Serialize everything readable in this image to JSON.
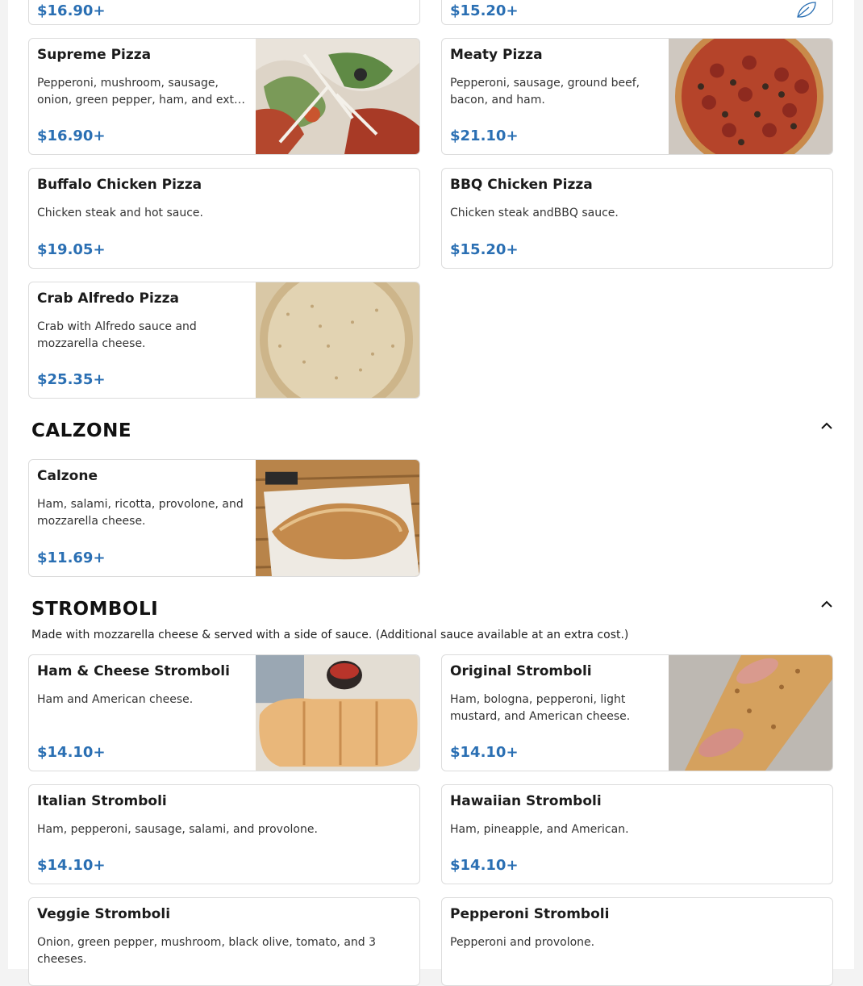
{
  "top_partial": {
    "left_price": "$16.90+",
    "right_price": "$15.20+",
    "right_icon": "leaf-icon"
  },
  "pizza": {
    "items": [
      {
        "name": "Supreme Pizza",
        "desc": "Pepperoni, mushroom, sausage,\nonion, green pepper, ham, and ext…",
        "price": "$16.90+"
      },
      {
        "name": "Meaty Pizza",
        "desc": "Pepperoni, sausage, ground beef,\nbacon, and ham.",
        "price": "$21.10+"
      },
      {
        "name": "Buffalo Chicken Pizza",
        "desc": "Chicken steak and hot sauce.",
        "price": "$19.05+"
      },
      {
        "name": "BBQ Chicken Pizza",
        "desc": "Chicken steak andBBQ sauce.",
        "price": "$15.20+"
      },
      {
        "name": "Crab Alfredo Pizza",
        "desc": "Crab with Alfredo sauce and\nmozzarella cheese.",
        "price": "$25.35+"
      }
    ]
  },
  "calzone": {
    "title": "CALZONE",
    "collapse_icon": "chevron-up-icon",
    "items": [
      {
        "name": "Calzone",
        "desc": "Ham, salami, ricotta, provolone, and\nmozzarella cheese.",
        "price": "$11.69+"
      }
    ]
  },
  "stromboli": {
    "title": "STROMBOLI",
    "note": "Made with mozzarella cheese & served with a side of sauce. (Additional sauce available at an extra cost.)",
    "collapse_icon": "chevron-up-icon",
    "items": [
      {
        "name": "Ham & Cheese Stromboli",
        "desc": "Ham and American cheese.",
        "price": "$14.10+"
      },
      {
        "name": "Original Stromboli",
        "desc": "Ham, bologna, pepperoni, light\nmustard, and American cheese.",
        "price": "$14.10+"
      },
      {
        "name": "Italian Stromboli",
        "desc": "Ham, pepperoni, sausage, salami, and provolone.",
        "price": "$14.10+"
      },
      {
        "name": "Hawaiian Stromboli",
        "desc": "Ham, pineapple, and American.",
        "price": "$14.10+"
      },
      {
        "name": "Veggie Stromboli",
        "desc": "Onion, green pepper, mushroom, black olive, tomato, and 3\ncheeses.",
        "price": ""
      },
      {
        "name": "Pepperoni Stromboli",
        "desc": "Pepperoni and provolone.",
        "price": ""
      }
    ]
  },
  "colors": {
    "price": "#2a6fb3",
    "card_border": "#dcdcdc",
    "background": "#f3f3f3"
  }
}
